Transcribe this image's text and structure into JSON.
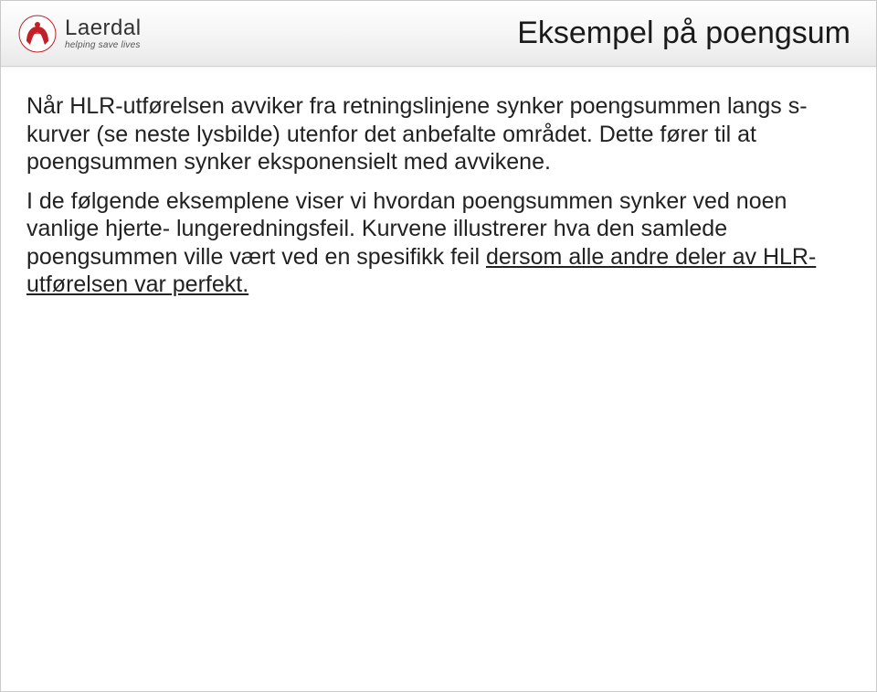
{
  "brand": {
    "word": "Laerdal",
    "tagline": "helping save lives"
  },
  "title": "Eksempel på poengsum",
  "para1_a": "Når HLR-utførelsen avviker fra retningslinjene synker poengsummen langs s-kurver (se neste lysbilde) utenfor det anbefalte området. Dette fører til at poengsummen synker eksponensielt med avvikene.",
  "para2_a": "I de følgende eksemplene viser vi hvordan poengsummen synker ved noen vanlige hjerte- lungeredningsfeil. Kurvene illustrerer hva den samlede poengsummen ville vært ved en spesifikk feil ",
  "para2_u": "dersom alle andre deler av HLR- utførelsen var perfekt."
}
